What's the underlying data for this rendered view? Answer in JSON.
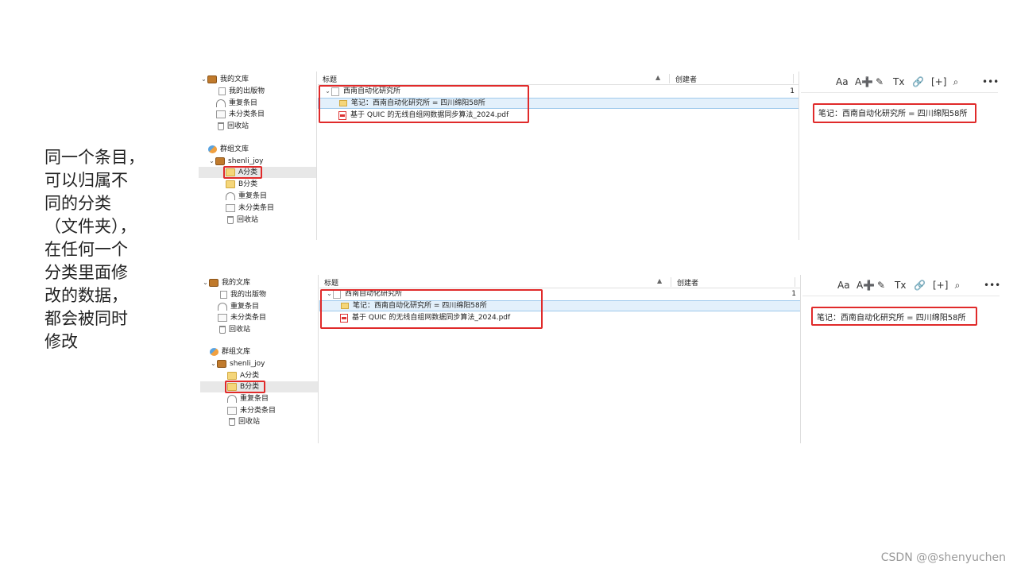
{
  "caption": "同一个条目，\n可以归属不\n同的分类\n（文件夹），\n在任何一个\n分类里面修\n改的数据，\n都会被同时\n修改",
  "watermark": "CSDN @@shenyuchen",
  "icons": {
    "library": "library-icon",
    "publications": "document-icon",
    "duplicates": "duplicates-icon",
    "unfiled": "unfiled-icon",
    "trash": "trash-icon",
    "group": "group-icon",
    "folder": "folder-icon",
    "note": "note-icon",
    "pdf": "pdf-icon",
    "toolbar": [
      "font-icon",
      "text-size-icon",
      "highlight-icon",
      "clear-format-icon",
      "link-icon",
      "insert-citation-icon",
      "search-icon",
      "more-icon"
    ]
  },
  "toolbar": {
    "font": "Aa",
    "text_size": "A➕",
    "highlight": "✎",
    "clear_format": "Tx",
    "link": "🔗",
    "cite": "[+]",
    "search": "⌕",
    "more": "•••"
  },
  "sidebar": {
    "my_library": "我的文库",
    "my_publications": "我的出版物",
    "duplicates": "重复条目",
    "unfiled": "未分类条目",
    "trash": "回收站",
    "group_libraries": "群组文库",
    "group_name": "shenli_joy",
    "collection_a": "A分类",
    "collection_b": "B分类",
    "group_duplicates": "重复条目",
    "group_unfiled": "未分类条目",
    "group_trash": "回收站"
  },
  "list": {
    "col_title": "标题",
    "col_creator": "创建者",
    "sort_arrow": "▲",
    "parent_title": "西南自动化研究所",
    "parent_count": "1",
    "note_title": "笔记：西南自动化研究所 = 四川绵阳58所",
    "pdf_title": "基于 QUIC 的无线自组网数据同步算法_2024.pdf"
  },
  "note_editor": {
    "content": "笔记：西南自动化研究所 = 四川绵阳58所"
  },
  "selection": {
    "shot1_selected_collection": "A分类",
    "shot2_selected_collection": "B分类"
  }
}
